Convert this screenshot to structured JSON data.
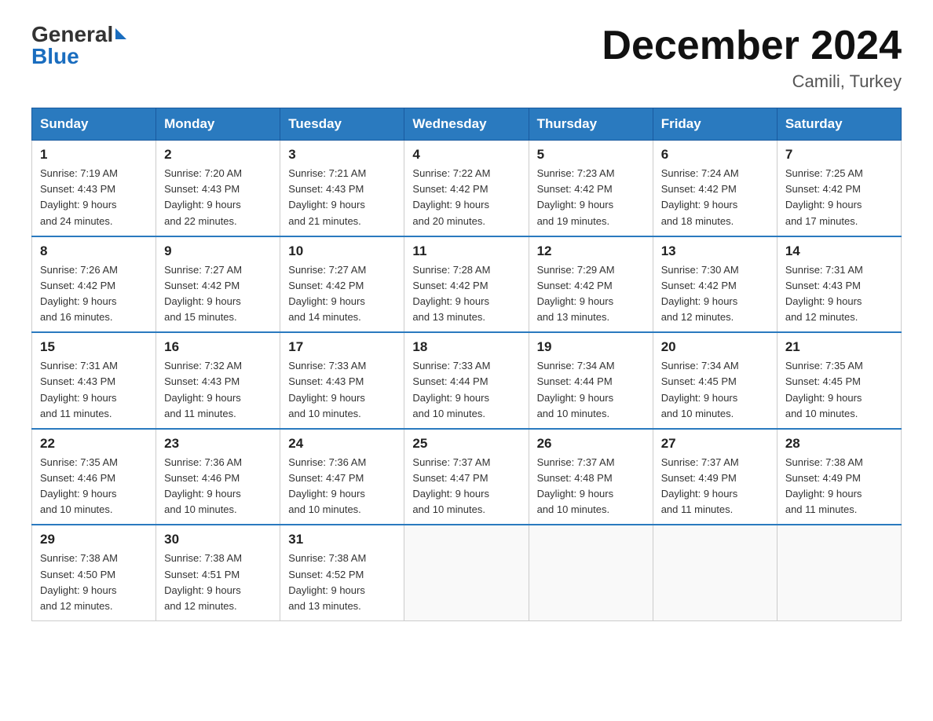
{
  "logo": {
    "general": "General",
    "blue": "Blue"
  },
  "title": "December 2024",
  "subtitle": "Camili, Turkey",
  "days_header": [
    "Sunday",
    "Monday",
    "Tuesday",
    "Wednesday",
    "Thursday",
    "Friday",
    "Saturday"
  ],
  "weeks": [
    [
      {
        "day": "1",
        "sunrise": "7:19 AM",
        "sunset": "4:43 PM",
        "daylight": "9 hours and 24 minutes."
      },
      {
        "day": "2",
        "sunrise": "7:20 AM",
        "sunset": "4:43 PM",
        "daylight": "9 hours and 22 minutes."
      },
      {
        "day": "3",
        "sunrise": "7:21 AM",
        "sunset": "4:43 PM",
        "daylight": "9 hours and 21 minutes."
      },
      {
        "day": "4",
        "sunrise": "7:22 AM",
        "sunset": "4:42 PM",
        "daylight": "9 hours and 20 minutes."
      },
      {
        "day": "5",
        "sunrise": "7:23 AM",
        "sunset": "4:42 PM",
        "daylight": "9 hours and 19 minutes."
      },
      {
        "day": "6",
        "sunrise": "7:24 AM",
        "sunset": "4:42 PM",
        "daylight": "9 hours and 18 minutes."
      },
      {
        "day": "7",
        "sunrise": "7:25 AM",
        "sunset": "4:42 PM",
        "daylight": "9 hours and 17 minutes."
      }
    ],
    [
      {
        "day": "8",
        "sunrise": "7:26 AM",
        "sunset": "4:42 PM",
        "daylight": "9 hours and 16 minutes."
      },
      {
        "day": "9",
        "sunrise": "7:27 AM",
        "sunset": "4:42 PM",
        "daylight": "9 hours and 15 minutes."
      },
      {
        "day": "10",
        "sunrise": "7:27 AM",
        "sunset": "4:42 PM",
        "daylight": "9 hours and 14 minutes."
      },
      {
        "day": "11",
        "sunrise": "7:28 AM",
        "sunset": "4:42 PM",
        "daylight": "9 hours and 13 minutes."
      },
      {
        "day": "12",
        "sunrise": "7:29 AM",
        "sunset": "4:42 PM",
        "daylight": "9 hours and 13 minutes."
      },
      {
        "day": "13",
        "sunrise": "7:30 AM",
        "sunset": "4:42 PM",
        "daylight": "9 hours and 12 minutes."
      },
      {
        "day": "14",
        "sunrise": "7:31 AM",
        "sunset": "4:43 PM",
        "daylight": "9 hours and 12 minutes."
      }
    ],
    [
      {
        "day": "15",
        "sunrise": "7:31 AM",
        "sunset": "4:43 PM",
        "daylight": "9 hours and 11 minutes."
      },
      {
        "day": "16",
        "sunrise": "7:32 AM",
        "sunset": "4:43 PM",
        "daylight": "9 hours and 11 minutes."
      },
      {
        "day": "17",
        "sunrise": "7:33 AM",
        "sunset": "4:43 PM",
        "daylight": "9 hours and 10 minutes."
      },
      {
        "day": "18",
        "sunrise": "7:33 AM",
        "sunset": "4:44 PM",
        "daylight": "9 hours and 10 minutes."
      },
      {
        "day": "19",
        "sunrise": "7:34 AM",
        "sunset": "4:44 PM",
        "daylight": "9 hours and 10 minutes."
      },
      {
        "day": "20",
        "sunrise": "7:34 AM",
        "sunset": "4:45 PM",
        "daylight": "9 hours and 10 minutes."
      },
      {
        "day": "21",
        "sunrise": "7:35 AM",
        "sunset": "4:45 PM",
        "daylight": "9 hours and 10 minutes."
      }
    ],
    [
      {
        "day": "22",
        "sunrise": "7:35 AM",
        "sunset": "4:46 PM",
        "daylight": "9 hours and 10 minutes."
      },
      {
        "day": "23",
        "sunrise": "7:36 AM",
        "sunset": "4:46 PM",
        "daylight": "9 hours and 10 minutes."
      },
      {
        "day": "24",
        "sunrise": "7:36 AM",
        "sunset": "4:47 PM",
        "daylight": "9 hours and 10 minutes."
      },
      {
        "day": "25",
        "sunrise": "7:37 AM",
        "sunset": "4:47 PM",
        "daylight": "9 hours and 10 minutes."
      },
      {
        "day": "26",
        "sunrise": "7:37 AM",
        "sunset": "4:48 PM",
        "daylight": "9 hours and 10 minutes."
      },
      {
        "day": "27",
        "sunrise": "7:37 AM",
        "sunset": "4:49 PM",
        "daylight": "9 hours and 11 minutes."
      },
      {
        "day": "28",
        "sunrise": "7:38 AM",
        "sunset": "4:49 PM",
        "daylight": "9 hours and 11 minutes."
      }
    ],
    [
      {
        "day": "29",
        "sunrise": "7:38 AM",
        "sunset": "4:50 PM",
        "daylight": "9 hours and 12 minutes."
      },
      {
        "day": "30",
        "sunrise": "7:38 AM",
        "sunset": "4:51 PM",
        "daylight": "9 hours and 12 minutes."
      },
      {
        "day": "31",
        "sunrise": "7:38 AM",
        "sunset": "4:52 PM",
        "daylight": "9 hours and 13 minutes."
      },
      null,
      null,
      null,
      null
    ]
  ]
}
